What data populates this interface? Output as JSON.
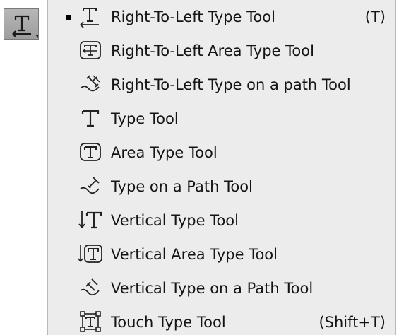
{
  "tool_button": {
    "icon": "type-tool-icon"
  },
  "menu": {
    "items": [
      {
        "label": "Right-To-Left Type Tool",
        "shortcut": "(T)",
        "icon": "right-to-left-type-icon",
        "selected": true
      },
      {
        "label": "Right-To-Left Area Type Tool",
        "shortcut": "",
        "icon": "right-to-left-area-type-icon",
        "selected": false
      },
      {
        "label": "Right-To-Left Type on a path Tool",
        "shortcut": "",
        "icon": "right-to-left-type-on-path-icon",
        "selected": false
      },
      {
        "label": "Type Tool",
        "shortcut": "",
        "icon": "type-icon",
        "selected": false
      },
      {
        "label": "Area Type Tool",
        "shortcut": "",
        "icon": "area-type-icon",
        "selected": false
      },
      {
        "label": "Type on a Path Tool",
        "shortcut": "",
        "icon": "type-on-path-icon",
        "selected": false
      },
      {
        "label": "Vertical Type Tool",
        "shortcut": "",
        "icon": "vertical-type-icon",
        "selected": false
      },
      {
        "label": "Vertical Area Type Tool",
        "shortcut": "",
        "icon": "vertical-area-type-icon",
        "selected": false
      },
      {
        "label": "Vertical Type on a Path Tool",
        "shortcut": "",
        "icon": "vertical-type-on-path-icon",
        "selected": false
      },
      {
        "label": "Touch Type Tool",
        "shortcut": "(Shift+T)",
        "icon": "touch-type-icon",
        "selected": false
      }
    ]
  }
}
